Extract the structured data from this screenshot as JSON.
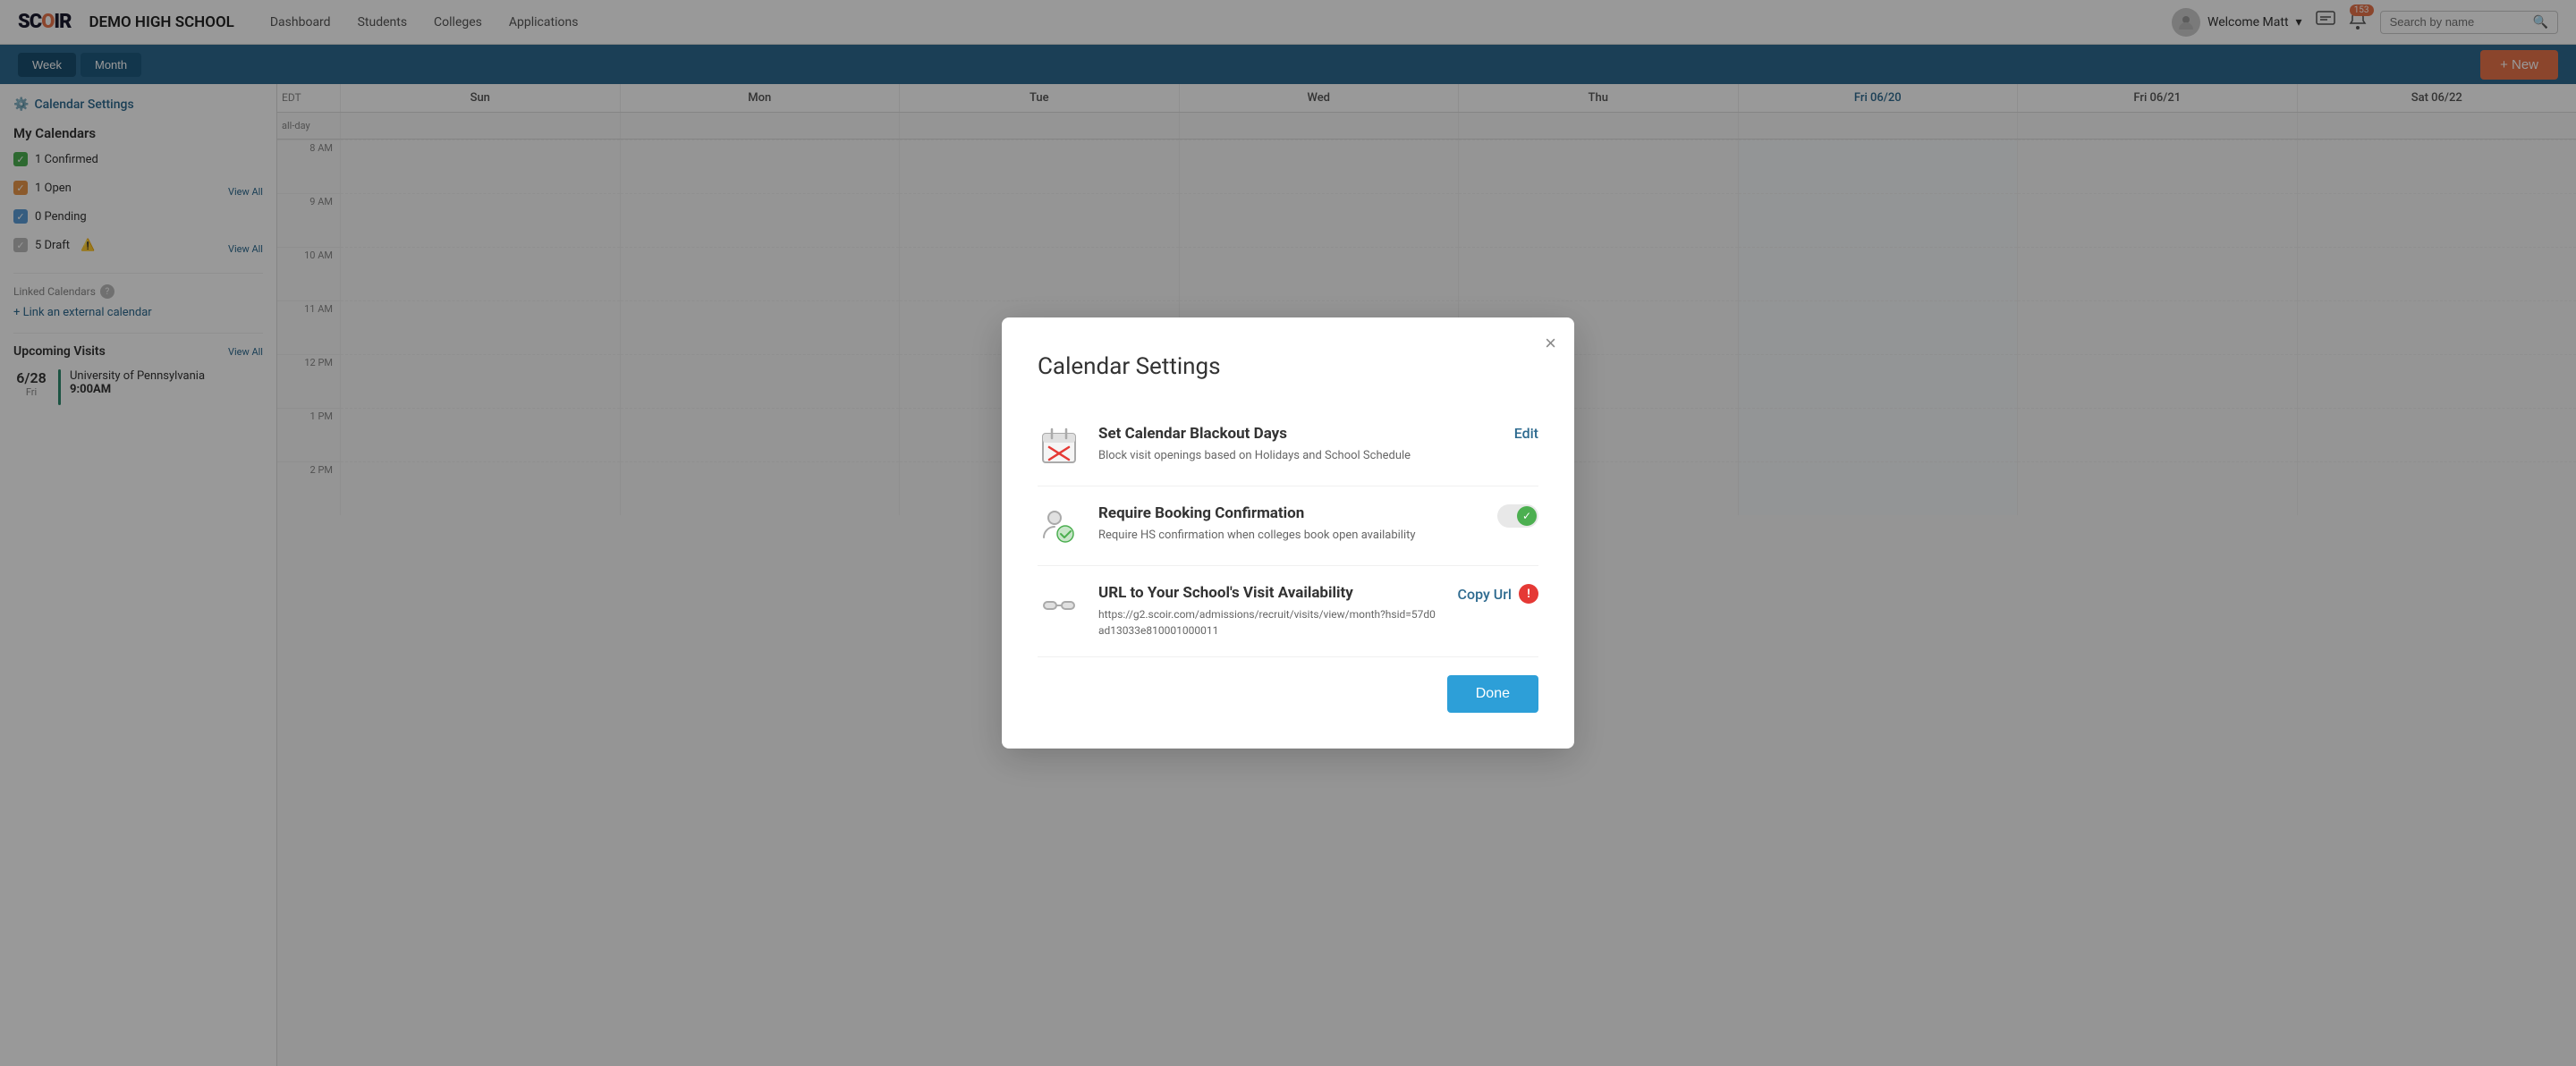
{
  "app": {
    "logo": "SCOIR",
    "school_name": "DEMO HIGH SCHOOL"
  },
  "top_nav": {
    "links": [
      "Dashboard",
      "Students",
      "Colleges",
      "Applications"
    ],
    "user_label": "Welcome Matt",
    "user_caret": "▾",
    "notification_count": "153",
    "search_placeholder": "Search by name"
  },
  "sub_nav": {
    "week_label": "Week",
    "month_label": "Month",
    "new_button": "+ New"
  },
  "sidebar": {
    "settings_label": "Calendar Settings",
    "my_calendars_label": "My Calendars",
    "calendars": [
      {
        "label": "1 Confirmed",
        "color": "green",
        "show_view_all": false
      },
      {
        "label": "1 Open",
        "color": "orange",
        "show_view_all": true
      },
      {
        "label": "0 Pending",
        "color": "blue",
        "show_view_all": false
      },
      {
        "label": "5 Draft",
        "color": "gray",
        "show_view_all": true,
        "warning": true
      }
    ],
    "view_all_label": "View All",
    "linked_calendars_label": "Linked Calendars",
    "link_external_label": "+ Link an external calendar",
    "upcoming_visits_label": "Upcoming Visits",
    "upcoming_view_all": "View All",
    "upcoming_visits": [
      {
        "date_num": "6/28",
        "date_day": "Fri",
        "school": "University of Pennsylvania",
        "time": "9:00AM"
      }
    ]
  },
  "calendar": {
    "edt_label": "EDT",
    "days": [
      {
        "label": "Sun",
        "date": ""
      },
      {
        "label": "Mon",
        "date": ""
      },
      {
        "label": "Tue",
        "date": ""
      },
      {
        "label": "Wed",
        "date": ""
      },
      {
        "label": "Thu",
        "date": ""
      },
      {
        "label": "Fri 06/20",
        "date": "06/20",
        "today": true
      },
      {
        "label": "Fri",
        "date": "06/21"
      },
      {
        "label": "Sat",
        "date": "06/22"
      }
    ],
    "time_slots": [
      "8 AM",
      "9 AM",
      "10 AM",
      "11 AM",
      "12 PM",
      "1 PM",
      "2 PM"
    ],
    "allday_label": "all-day"
  },
  "modal": {
    "title": "Calendar Settings",
    "close_label": "×",
    "sections": [
      {
        "id": "blackout",
        "title": "Set Calendar Blackout Days",
        "description": "Block visit openings based on Holidays and School Schedule",
        "action_type": "edit",
        "action_label": "Edit"
      },
      {
        "id": "booking",
        "title": "Require Booking Confirmation",
        "description": "Require HS confirmation when colleges book open availability",
        "action_type": "toggle",
        "toggle_on": true
      },
      {
        "id": "url",
        "title": "URL to Your School's Visit Availability",
        "url": "https://g2.scoir.com/admissions/recruit/visits/view/month?hsid=57d0ad13033e810001000011",
        "action_type": "copy",
        "action_label": "Copy Url"
      }
    ],
    "done_label": "Done"
  }
}
